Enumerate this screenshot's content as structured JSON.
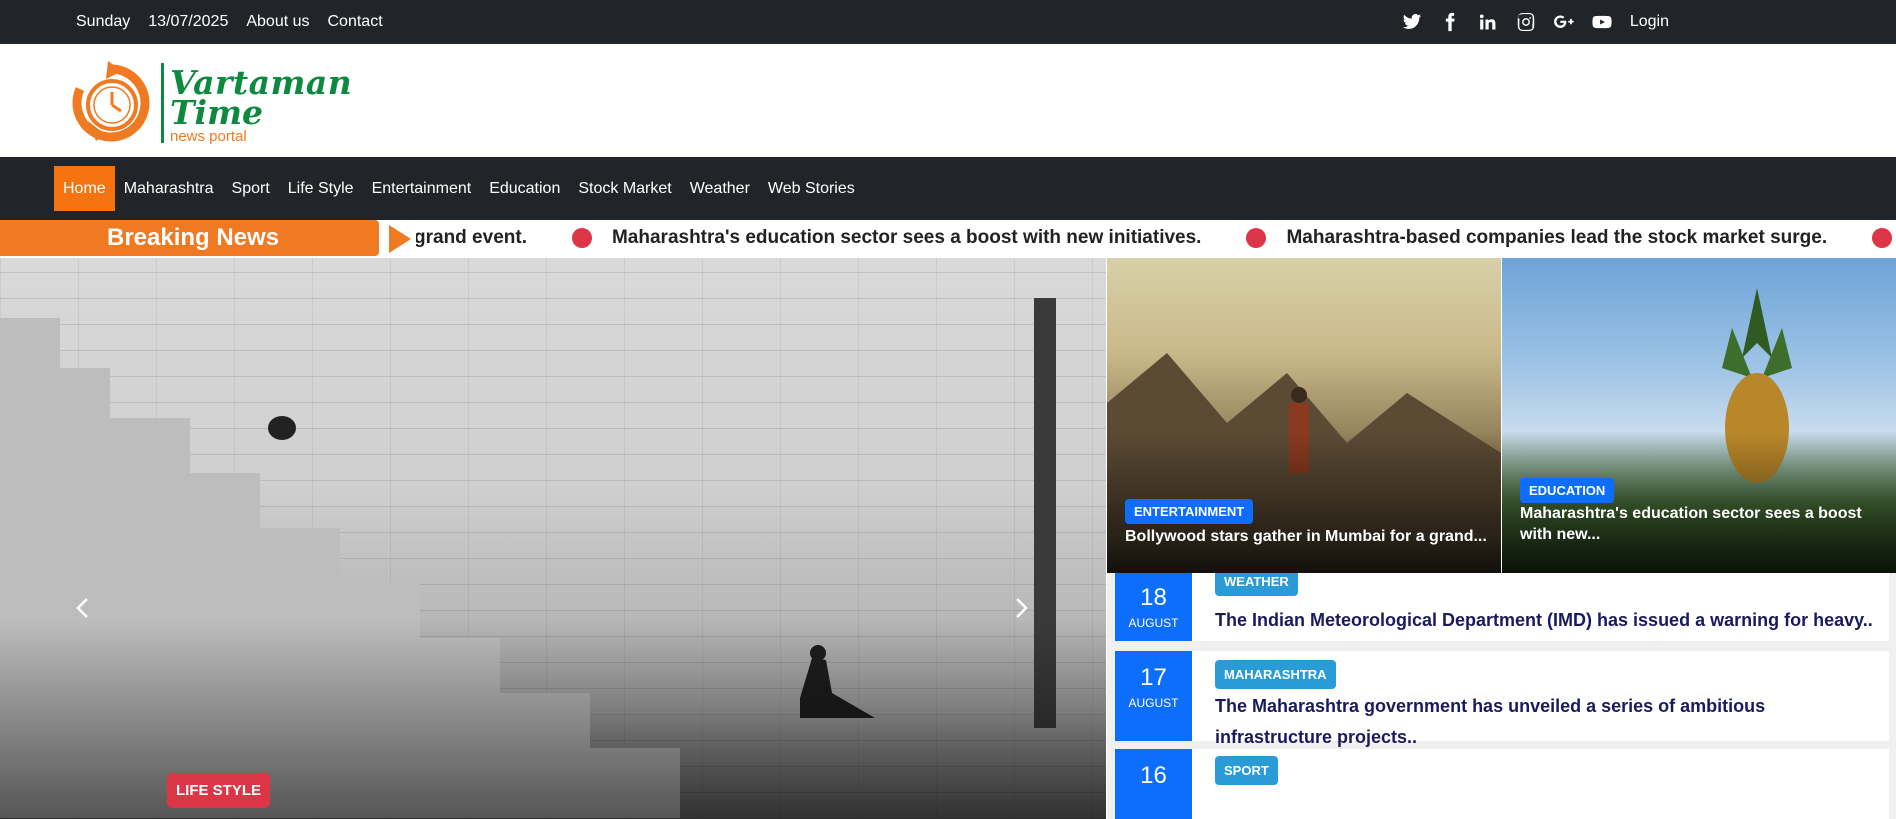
{
  "topbar": {
    "day": "Sunday",
    "date": "13/07/2025",
    "about": "About us",
    "contact": "Contact",
    "login": "Login",
    "social_icons": [
      "twitter-icon",
      "facebook-icon",
      "linkedin-icon",
      "instagram-icon",
      "google-plus-icon",
      "youtube-icon"
    ]
  },
  "logo": {
    "line1": "Vartaman",
    "line2": "Time",
    "tagline": "news portal",
    "colors": {
      "green": "#0d8a3f",
      "orange": "#f07a22"
    }
  },
  "nav": {
    "items": [
      "Home",
      "Maharashtra",
      "Sport",
      "Life Style",
      "Entertainment",
      "Education",
      "Stock Market",
      "Weather",
      "Web Stories"
    ],
    "active": "Home",
    "active_color": "#f5740f"
  },
  "breaking": {
    "label": "Breaking News",
    "items": [
      "grand event.",
      "Maharashtra's education sector sees a boost with new initiatives.",
      "Maharashtra-based companies lead the stock market surge."
    ]
  },
  "hero": {
    "category": "LIFE STYLE",
    "prev": "‹",
    "next": "›"
  },
  "featured": [
    {
      "category": "ENTERTAINMENT",
      "title": "Bollywood stars gather in Mumbai for a grand..."
    },
    {
      "category": "EDUCATION",
      "title": "Maharashtra's education sector sees a boost with new..."
    }
  ],
  "news": [
    {
      "day": "18",
      "month": "AUGUST",
      "category": "WEATHER",
      "title": "The Indian Meteorological Department (IMD) has issued a warning for heavy.."
    },
    {
      "day": "17",
      "month": "AUGUST",
      "category": "MAHARASHTRA",
      "title": "The Maharashtra government has unveiled a series of ambitious infrastructure projects.."
    },
    {
      "day": "16",
      "month": "",
      "category": "SPORT",
      "title": ""
    }
  ]
}
